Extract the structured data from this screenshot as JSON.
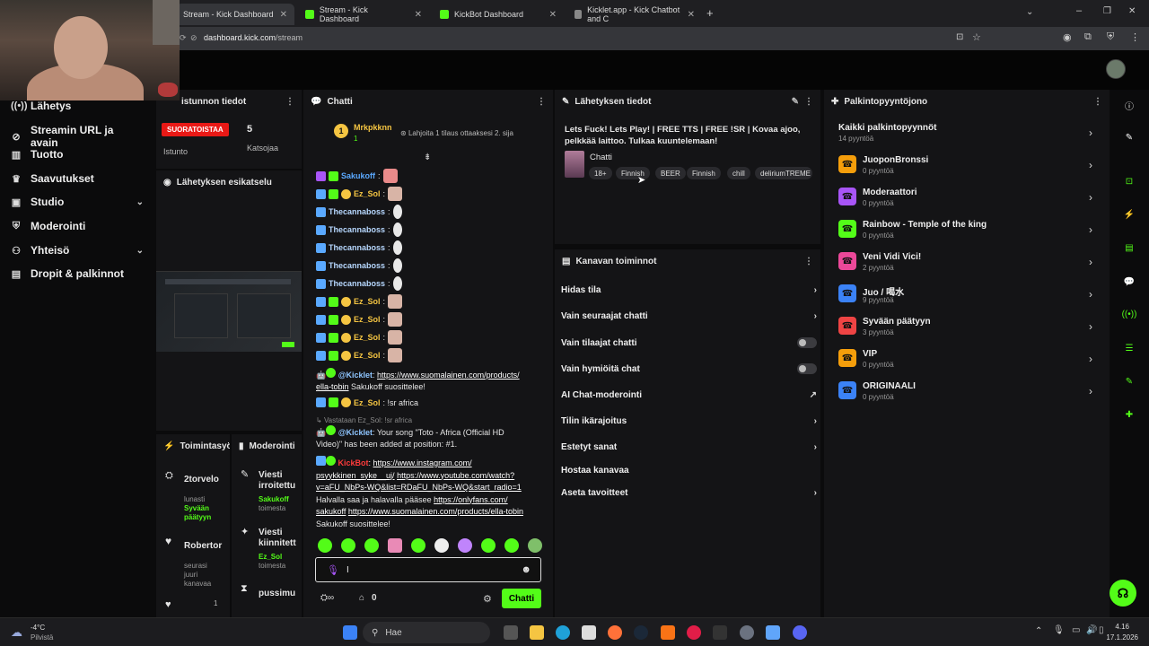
{
  "browser": {
    "tabs": [
      {
        "label": "Stream - Kick Dashboard",
        "active": true
      },
      {
        "label": "Stream - Kick Dashboard"
      },
      {
        "label": "KickBot Dashboard"
      },
      {
        "label": "Kicklet.app - Kick Chatbot and C"
      }
    ],
    "url_domain": "dashboard.kick.com",
    "url_path": "/stream"
  },
  "sidebar": {
    "items": [
      {
        "label": "Lähetys",
        "icon": "broadcast-icon"
      },
      {
        "label": "Streamin URL ja avain",
        "icon": "link-icon"
      },
      {
        "label": "Tuotto",
        "icon": "chart-icon"
      },
      {
        "label": "Saavutukset",
        "icon": "trophy-icon"
      },
      {
        "label": "Studio",
        "icon": "studio-icon",
        "expand": true
      },
      {
        "label": "Moderointi",
        "icon": "shield-icon"
      },
      {
        "label": "Yhteisö",
        "icon": "users-icon",
        "expand": true
      },
      {
        "label": "Dropit & palkinnot",
        "icon": "gift-icon"
      }
    ]
  },
  "session": {
    "header": "istunnon tiedot",
    "live_badge": "SUORATOISTAA",
    "session_label": "Istunto",
    "viewers_value": "5",
    "viewers_label": "Katsojaa"
  },
  "preview": {
    "header": "Lähetyksen esikatselu"
  },
  "activity": {
    "header": "Toimintasyöte",
    "items": [
      {
        "user": "2torvelo",
        "line1": "lunasti",
        "line2": "Syvään",
        "line3": "päätyyn"
      },
      {
        "user": "Robertor",
        "line1": "seurasi",
        "line2": "juuri",
        "line3": "kanavaa"
      }
    ],
    "heart_count": "1"
  },
  "modlog": {
    "header": "Moderointi",
    "items": [
      {
        "title1": "Viesti",
        "title2": "irroitettu",
        "user": "Sakukoff",
        "sub": "toimesta"
      },
      {
        "title1": "Viesti",
        "title2": "kiinnitett",
        "user": "Ez_Sol",
        "sub": "toimesta"
      },
      {
        "title1": "pussimu",
        "title2": "",
        "user": "",
        "sub": ""
      }
    ]
  },
  "chat": {
    "header": "Chatti",
    "top_gifter_name": "Mrkpkknn",
    "top_gifter_count": "1",
    "gift_hint": "Lahjoita 1 tilaus ottaaksesi 2. sija",
    "messages": [
      {
        "user": "Sakukoff",
        "text": ":"
      },
      {
        "user": "Ez_Sol",
        "text": ":"
      },
      {
        "user": "Thecannaboss",
        "text": ":"
      },
      {
        "user": "Thecannaboss",
        "text": ":"
      },
      {
        "user": "Thecannaboss",
        "text": ":"
      },
      {
        "user": "Thecannaboss",
        "text": ":"
      },
      {
        "user": "Thecannaboss",
        "text": ":"
      },
      {
        "user": "Ez_Sol",
        "text": ":"
      },
      {
        "user": "Ez_Sol",
        "text": ":"
      },
      {
        "user": "Ez_Sol",
        "text": ":"
      },
      {
        "user": "Ez_Sol",
        "text": ":"
      }
    ],
    "kicklet1_user": "@Kicklet",
    "kicklet1_link1": "https://www.suomalainen.com/products/",
    "kicklet1_link2": "ella-tobin",
    "kicklet1_tail": "Sakukoff suosittelee!",
    "ezsol_user": "Ez_Sol",
    "ezsol_text": ": !sr africa",
    "reply_hint": "Vastataan Ez_Sol: !sr africa",
    "kicklet2_user": "@Kicklet",
    "kicklet2_text1": ": Your song \"Toto - Africa (Official HD",
    "kicklet2_text2": "Video)\" has been added at position: #1.",
    "kickbot_user": "KickBot",
    "kickbot_l1": "https://www.instagram.com/",
    "kickbot_l2a": "psyykkinen_syke__uj/",
    "kickbot_l2b": "https://www.youtube.com/watch?",
    "kickbot_l3": "v=aFU_NbPs-WQ&list=RDaFU_NbPs-WQ&start_radio=1",
    "kickbot_l4a": "Halvalla saa ja halavalla pääsee",
    "kickbot_l4b": "https://onlyfans.com/",
    "kickbot_l5a": "sakukoff",
    "kickbot_l5b": "https://www.suomalainen.com/products/ella-tobin",
    "kickbot_l6": "Sakukoff suosittelee!",
    "input_value": "I",
    "points_count": "0",
    "send_label": "Chatti"
  },
  "stream_info": {
    "header": "Lähetyksen tiedot",
    "title1": "Lets Fuck! Lets Play! | FREE TTS | FREE !SR | Kovaa ajoo,",
    "title2": "pelkkää laittoo. Tulkaa kuuntelemaan!",
    "category": "Chatti",
    "tags": [
      "18+",
      "Finnish",
      "BEER",
      "Finnish",
      "chill",
      "deliriumTREME"
    ]
  },
  "channel_actions": {
    "header": "Kanavan toiminnot",
    "items": [
      {
        "label": "Hidas tila",
        "kind": "arrow"
      },
      {
        "label": "Vain seuraajat chatti",
        "kind": "arrow"
      },
      {
        "label": "Vain tilaajat chatti",
        "kind": "toggle"
      },
      {
        "label": "Vain hymiöitä chat",
        "kind": "toggle"
      },
      {
        "label": "AI Chat-moderointi",
        "kind": "external"
      },
      {
        "label": "Tilin ikärajoitus",
        "kind": "arrow"
      },
      {
        "label": "Estetyt sanat",
        "kind": "arrow"
      },
      {
        "label": "Hostaa kanavaa",
        "kind": "none"
      },
      {
        "label": "Aseta tavoitteet",
        "kind": "arrow"
      }
    ]
  },
  "rewards": {
    "header": "Palkintopyyntöjono",
    "all_label": "Kaikki palkintopyynnöt",
    "all_count": "14 pyyntöä",
    "items": [
      {
        "name": "JuoponBronssi",
        "count": "0 pyyntöä",
        "color": "#f59e0b"
      },
      {
        "name": "Moderaattori",
        "count": "0 pyyntöä",
        "color": "#a855f7"
      },
      {
        "name": "Rainbow - Temple of the king",
        "count": "0 pyyntöä",
        "color": "#53fc18"
      },
      {
        "name": "Veni Vidi Vici!",
        "count": "2 pyyntöä",
        "color": "#ec4899"
      },
      {
        "name": "Juo / 喝水",
        "count": "9 pyyntöä",
        "color": "#3b82f6"
      },
      {
        "name": "Syvään päätyyn",
        "count": "3 pyyntöä",
        "color": "#ef4444"
      },
      {
        "name": "VIP",
        "count": "0 pyyntöä",
        "color": "#f59e0b"
      },
      {
        "name": "ORIGINAALI",
        "count": "0 pyyntöä",
        "color": "#3b82f6"
      }
    ]
  },
  "taskbar": {
    "weather_temp": "-4°C",
    "weather_desc": "Pilvistä",
    "search": "Hae",
    "time": "4.16",
    "date": "17.1.2026"
  },
  "colors": {
    "kick_green": "#53fc18",
    "live_red": "#e91916"
  }
}
